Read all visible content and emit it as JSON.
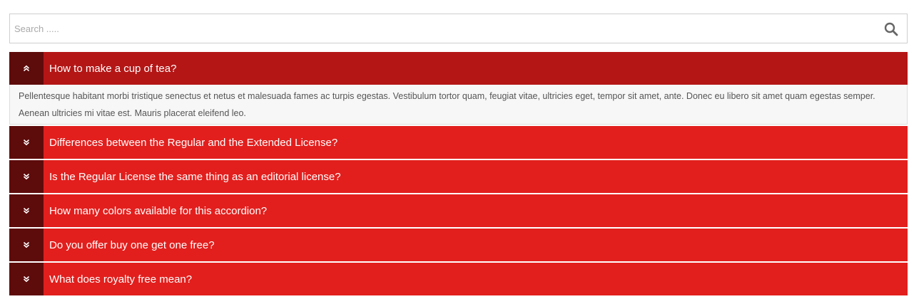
{
  "search": {
    "placeholder": "Search .....",
    "icon": "search-icon"
  },
  "colors": {
    "header": "#e21f1d",
    "header_active": "#b41616",
    "toggle": "#5e0b0b",
    "text": "#ffffff",
    "body_bg": "#f7f7f7"
  },
  "accordion": {
    "items": [
      {
        "title": "How to make a cup of tea?",
        "open": true,
        "icon": "chevron-double-up-icon",
        "content": "Pellentesque habitant morbi tristique senectus et netus et malesuada fames ac turpis egestas. Vestibulum tortor quam, feugiat vitae, ultricies eget, tempor sit amet, ante. Donec eu libero sit amet quam egestas semper. Aenean ultricies mi vitae est. Mauris placerat eleifend leo."
      },
      {
        "title": "Differences between the Regular and the Extended License?",
        "open": false,
        "icon": "chevron-double-down-icon"
      },
      {
        "title": "Is the Regular License the same thing as an editorial license?",
        "open": false,
        "icon": "chevron-double-down-icon"
      },
      {
        "title": "How many colors available for this accordion?",
        "open": false,
        "icon": "chevron-double-down-icon"
      },
      {
        "title": "Do you offer buy one get one free?",
        "open": false,
        "icon": "chevron-double-down-icon"
      },
      {
        "title": "What does royalty free mean?",
        "open": false,
        "icon": "chevron-double-down-icon"
      }
    ]
  }
}
